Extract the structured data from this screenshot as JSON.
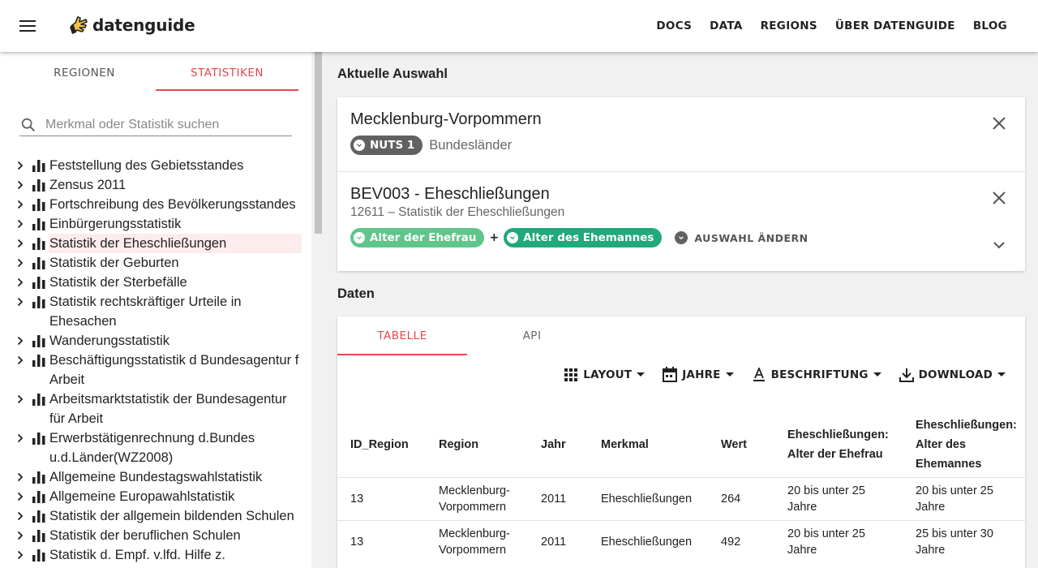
{
  "header": {
    "logo_text": "datenguide",
    "nav": [
      "DOCS",
      "DATA",
      "REGIONS",
      "ÜBER DATENGUIDE",
      "BLOG"
    ]
  },
  "sidebar": {
    "tabs": [
      "REGIONEN",
      "STATISTIKEN"
    ],
    "active_tab": "STATISTIKEN",
    "search": {
      "placeholder": "Merkmal oder Statistik suchen",
      "value": ""
    },
    "items": [
      {
        "label": "Feststellung des Gebietsstandes"
      },
      {
        "label": "Zensus 2011"
      },
      {
        "label": "Fortschreibung des Bevölkerungsstandes"
      },
      {
        "label": "Einbürgerungsstatistik"
      },
      {
        "label": "Statistik der Eheschließungen",
        "selected": true
      },
      {
        "label": "Statistik der Geburten"
      },
      {
        "label": "Statistik der Sterbefälle"
      },
      {
        "label": "Statistik rechtskräftiger Urteile in Ehesachen"
      },
      {
        "label": "Wanderungsstatistik"
      },
      {
        "label": "Beschäftigungsstatistik d Bundesagentur f Arbeit"
      },
      {
        "label": "Arbeitsmarktstatistik der Bundesagentur für Arbeit"
      },
      {
        "label": "Erwerbstätigenrechnung d.Bundes u.d.Länder(WZ2008)"
      },
      {
        "label": "Allgemeine Bundestagswahlstatistik"
      },
      {
        "label": "Allgemeine Europawahlstatistik"
      },
      {
        "label": "Statistik der allgemein bildenden Schulen"
      },
      {
        "label": "Statistik der beruflichen Schulen"
      },
      {
        "label": "Statistik d. Empf. v.lfd. Hilfe z."
      }
    ]
  },
  "main": {
    "selection_title": "Aktuelle Auswahl",
    "region": {
      "name": "Mecklenburg-Vorpommern",
      "chip": "NUTS 1",
      "level": "Bundesländer"
    },
    "statistic": {
      "title": "BEV003 - Eheschließungen",
      "subtitle": "12611 – Statistik der Eheschließungen",
      "chips": [
        "Alter der Ehefrau",
        "Alter des Ehemannes"
      ],
      "plus": "+",
      "change_label": "AUSWAHL ÄNDERN"
    },
    "data_title": "Daten",
    "data_tabs": [
      "TABELLE",
      "API"
    ],
    "active_data_tab": "TABELLE",
    "toolbar": [
      "LAYOUT",
      "JAHRE",
      "BESCHRIFTUNG",
      "DOWNLOAD"
    ],
    "table": {
      "headers": [
        "ID_Region",
        "Region",
        "Jahr",
        "Merkmal",
        "Wert",
        "Eheschließungen: Alter der Ehefrau",
        "Eheschließungen: Alter des Ehemannes"
      ],
      "rows": [
        [
          "13",
          "Mecklenburg-Vorpommern",
          "2011",
          "Eheschließungen",
          "264",
          "20 bis unter 25 Jahre",
          "20 bis unter 25 Jahre"
        ],
        [
          "13",
          "Mecklenburg-Vorpommern",
          "2011",
          "Eheschließungen",
          "492",
          "20 bis unter 25 Jahre",
          "25 bis unter 30 Jahre"
        ]
      ]
    }
  },
  "colors": {
    "accent": "#e5474c",
    "chip_gray": "#616161",
    "chip_green": "#5fc58b",
    "chip_teal": "#20a97a"
  }
}
